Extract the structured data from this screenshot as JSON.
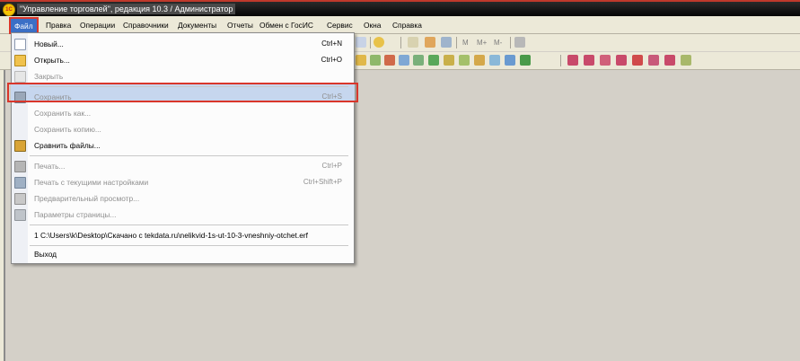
{
  "window": {
    "title": "\"Управление торговлей\", редакция 10.3 / Администратор",
    "icon_label": "1С"
  },
  "menubar": {
    "items": [
      "Файл",
      "Правка",
      "Операции",
      "Справочники",
      "Документы",
      "Отчеты",
      "Обмен с ГосИС",
      "Сервис",
      "Окна",
      "Справка"
    ]
  },
  "toolbar": {
    "memory_buttons": [
      "M",
      "M+",
      "M-"
    ]
  },
  "file_menu": {
    "items": [
      {
        "label": "Новый...",
        "shortcut": "Ctrl+N",
        "icon": "new-document-icon",
        "enabled": true
      },
      {
        "label": "Открыть...",
        "shortcut": "Ctrl+O",
        "icon": "open-folder-icon",
        "enabled": true,
        "highlighted": true
      },
      {
        "label": "Закрыть",
        "shortcut": "",
        "icon": "close-document-icon",
        "enabled": false
      },
      {
        "label": "Сохранить",
        "shortcut": "Ctrl+S",
        "icon": "save-icon",
        "enabled": false
      },
      {
        "label": "Сохранить как...",
        "shortcut": "",
        "icon": "",
        "enabled": false
      },
      {
        "label": "Сохранить копию...",
        "shortcut": "",
        "icon": "",
        "enabled": false
      },
      {
        "label": "Сравнить файлы...",
        "shortcut": "",
        "icon": "compare-files-icon",
        "enabled": true
      },
      {
        "label": "Печать...",
        "shortcut": "Ctrl+P",
        "icon": "print-icon",
        "enabled": false
      },
      {
        "label": "Печать с текущими настройками",
        "shortcut": "Ctrl+Shift+P",
        "icon": "print-settings-icon",
        "enabled": false
      },
      {
        "label": "Предварительный просмотр...",
        "shortcut": "",
        "icon": "print-preview-icon",
        "enabled": false
      },
      {
        "label": "Параметры страницы...",
        "shortcut": "",
        "icon": "page-setup-icon",
        "enabled": false
      },
      {
        "label": "1 C:\\Users\\k\\Desktop\\Скачано с tekdata.ru\\nelikvid-1s-ut-10-3-vneshniy-otchet.erf",
        "shortcut": "",
        "icon": "",
        "enabled": true
      },
      {
        "label": "Выход",
        "shortcut": "",
        "icon": "",
        "enabled": true
      }
    ]
  },
  "colors": {
    "highlight_border": "#d9362b",
    "menu_selected_bg": "#3b6fc6",
    "item_hover_bg": "#c6d6ee"
  }
}
